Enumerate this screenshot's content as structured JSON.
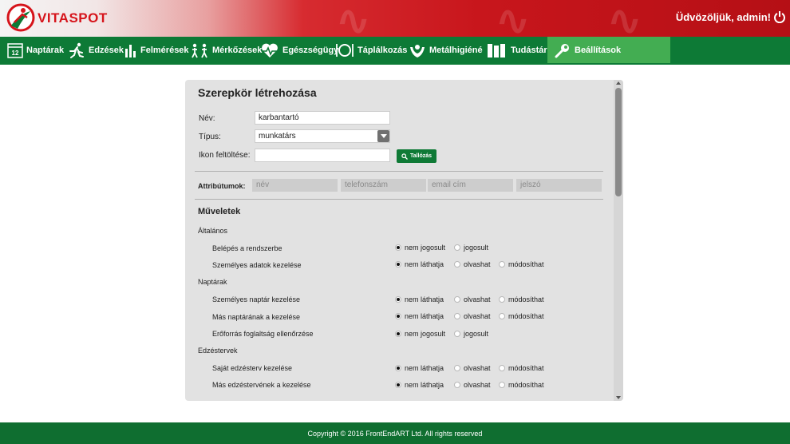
{
  "app": {
    "brand": "VITASPOT",
    "welcome": "Üdvözöljük, admin!"
  },
  "nav": {
    "items": [
      {
        "label": "Naptárak",
        "icon": "calendar-icon",
        "calendar_day": "12"
      },
      {
        "label": "Edzések",
        "icon": "runner-icon"
      },
      {
        "label": "Felmérések",
        "icon": "chart-icon"
      },
      {
        "label": "Mérkőzések",
        "icon": "players-icon"
      },
      {
        "label": "Egészségügy",
        "icon": "heartbeat-icon"
      },
      {
        "label": "Táplálkozás",
        "icon": "plate-icon"
      },
      {
        "label": "Metálhigiéné",
        "icon": "hands-icon"
      },
      {
        "label": "Tudástár",
        "icon": "books-icon"
      },
      {
        "label": "Beállítások",
        "icon": "wrench-icon"
      }
    ],
    "active": "Beállítások"
  },
  "form": {
    "title": "Szerepkör létrehozása",
    "name_label": "Név:",
    "name_value": "karbantartó",
    "type_label": "Típus:",
    "type_value": "munkatárs",
    "icon_label": "Ikon feltöltése:",
    "icon_value": "",
    "browse_label": "Tallózás",
    "attributes_label": "Attribútumok:",
    "attributes": [
      "név",
      "telefonszám",
      "email cím",
      "jelszó"
    ]
  },
  "operations": {
    "title": "Műveletek",
    "groups": [
      {
        "name": "Általános",
        "rows": [
          {
            "label": "Belépés a rendszerbe",
            "options": [
              "nem jogosult",
              "jogosult"
            ],
            "selected": 0
          },
          {
            "label": "Személyes adatok kezelése",
            "options": [
              "nem láthatja",
              "olvashat",
              "módosíthat"
            ],
            "selected": 0
          }
        ]
      },
      {
        "name": "Naptárak",
        "rows": [
          {
            "label": "Személyes naptár kezelése",
            "options": [
              "nem láthatja",
              "olvashat",
              "módosíthat"
            ],
            "selected": 0
          },
          {
            "label": "Más naptárának a kezelése",
            "options": [
              "nem láthatja",
              "olvashat",
              "módosíthat"
            ],
            "selected": 0
          },
          {
            "label": "Erőforrás foglaltság ellenőrzése",
            "options": [
              "nem jogosult",
              "jogosult"
            ],
            "selected": 0
          }
        ]
      },
      {
        "name": "Edzéstervek",
        "rows": [
          {
            "label": "Saját edzésterv kezelése",
            "options": [
              "nem láthatja",
              "olvashat",
              "módosíthat"
            ],
            "selected": 0
          },
          {
            "label": "Más edzéstervének a kezelése",
            "options": [
              "nem láthatja",
              "olvashat",
              "módosíthat"
            ],
            "selected": 0
          }
        ]
      }
    ]
  },
  "footer": {
    "copyright": "Copyright © 2016 FrontEndART Ltd. All rights reserved"
  },
  "colors": {
    "brand_red": "#d6141b",
    "nav_green": "#0d7a36",
    "active_green": "#43ad52",
    "footer_green": "#0f6e30"
  }
}
